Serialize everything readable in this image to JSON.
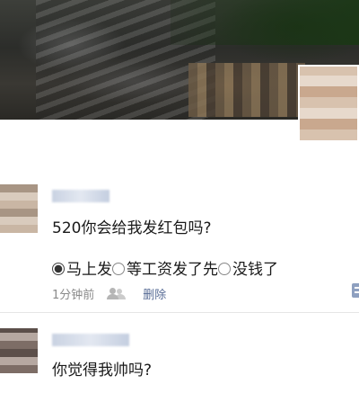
{
  "posts": [
    {
      "text": "520你会给我发红包吗?",
      "options": [
        "马上发",
        "等工资发了先",
        "没钱了"
      ],
      "time": "1分钟前",
      "delete_label": "删除"
    },
    {
      "text": "你觉得我帅吗?"
    }
  ],
  "colors": {
    "link": "#576b95",
    "meta": "#8a8a8a",
    "text": "#1a1a1a"
  }
}
